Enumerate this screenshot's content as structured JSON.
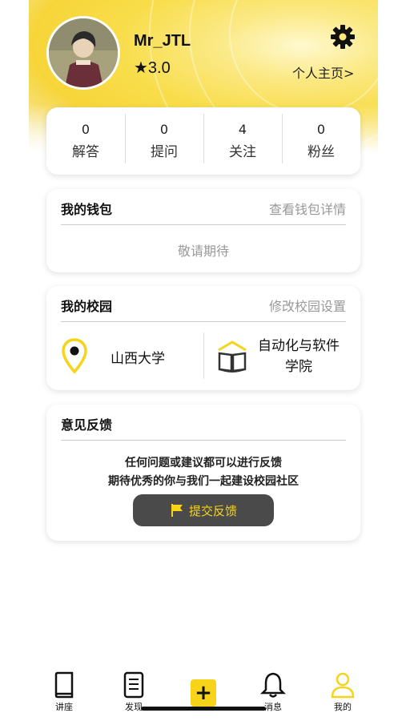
{
  "profile": {
    "username": "Mr_JTL",
    "rating": "★3.0",
    "profile_link": "个人主页>"
  },
  "stats": [
    {
      "value": "0",
      "label": "解答"
    },
    {
      "value": "0",
      "label": "提问"
    },
    {
      "value": "4",
      "label": "关注"
    },
    {
      "value": "0",
      "label": "粉丝"
    }
  ],
  "wallet": {
    "title": "我的钱包",
    "link": "查看钱包详情",
    "status": "敬请期待"
  },
  "campus": {
    "title": "我的校园",
    "link": "修改校园设置",
    "school": "山西大学",
    "college_line1": "自动化与软件",
    "college_line2": "学院"
  },
  "feedback": {
    "title": "意见反馈",
    "line1": "任何问题或建议都可以进行反馈",
    "line2": "期待优秀的你与我们一起建设校园社区",
    "button": "提交反馈"
  },
  "tabbar": {
    "lecture": "讲座",
    "discover": "发现",
    "messages": "消息",
    "mine": "我的"
  },
  "colors": {
    "accent": "#f7d31a",
    "button_bg": "#4a4a4a",
    "muted": "#999999"
  }
}
